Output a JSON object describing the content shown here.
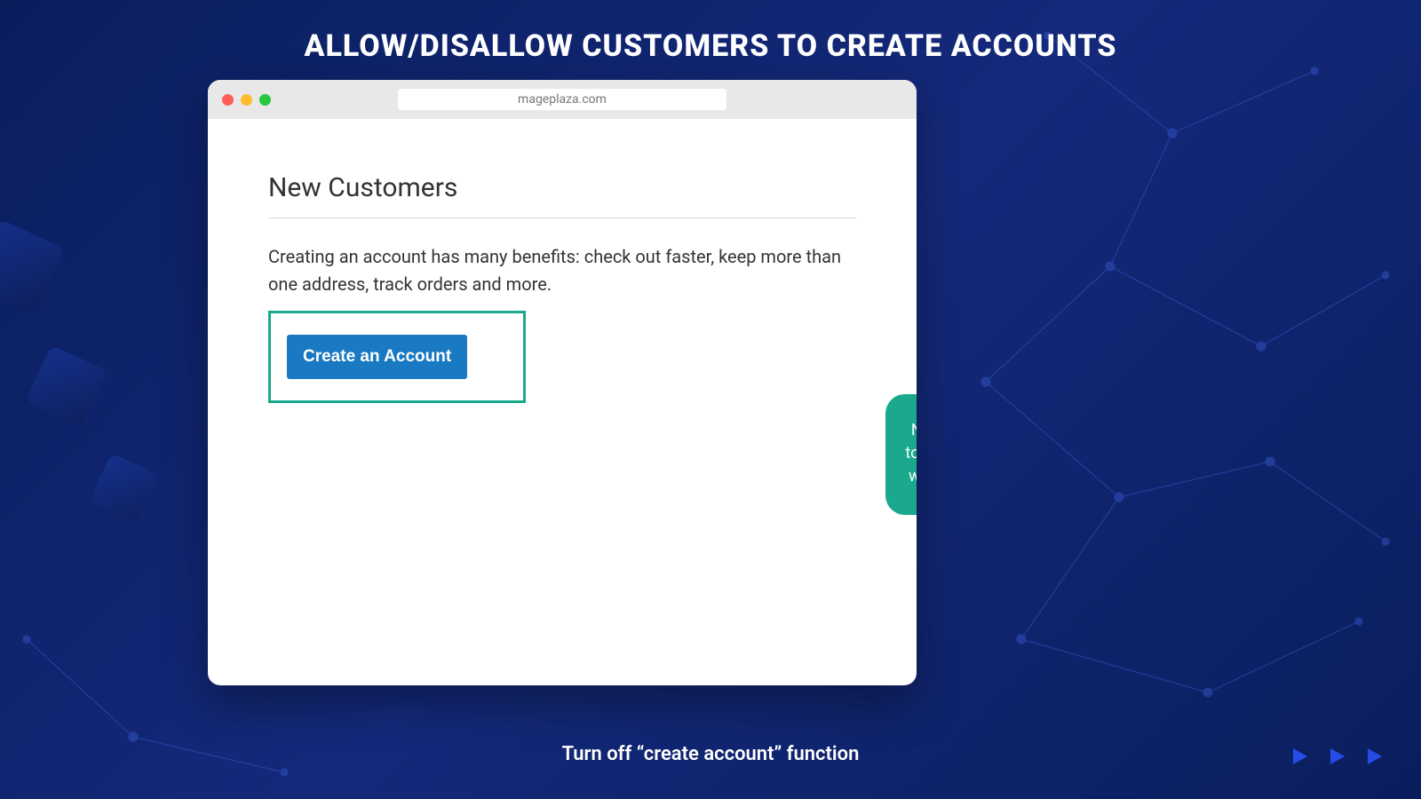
{
  "headline": "ALLOW/DISALLOW CUSTOMERS TO CREATE ACCOUNTS",
  "caption": "Turn off “create account” function",
  "browser": {
    "address": "mageplaza.com",
    "page_title": "New Customers",
    "page_desc": "Creating an account has many benefits: check out faster, keep more than one address, track orders and more.",
    "create_button_label": "Create an Account"
  },
  "callout_text": "New visitors are required to register accounts which will be used for login step"
}
